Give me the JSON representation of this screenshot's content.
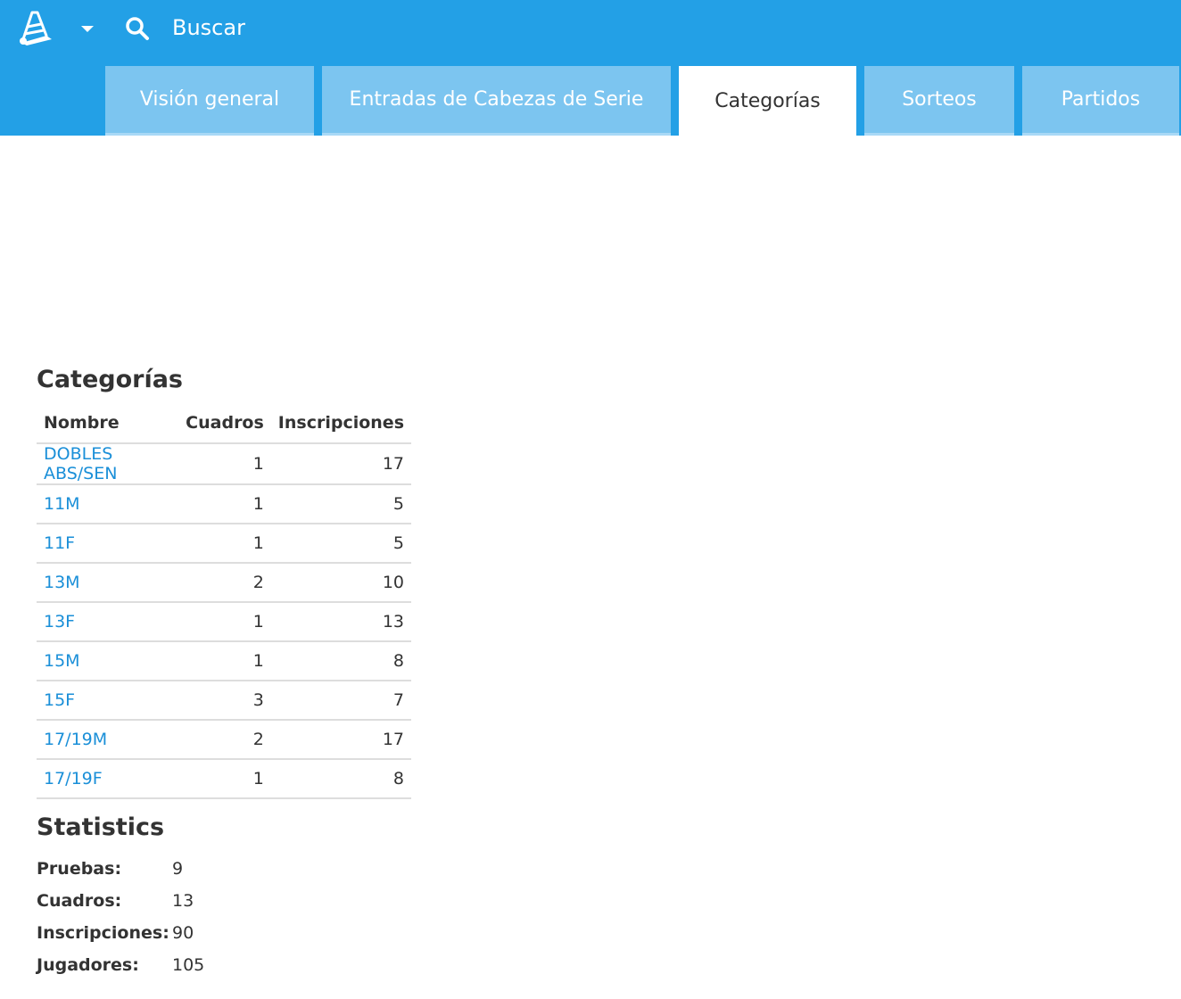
{
  "header": {
    "search_label": "Buscar",
    "brand_color": "#23a0e6",
    "tab_color": "#7cc5f0"
  },
  "tabs": [
    {
      "label": "Visión general",
      "active": false
    },
    {
      "label": "Entradas de Cabezas de Serie",
      "active": false
    },
    {
      "label": "Categorías",
      "active": true
    },
    {
      "label": "Sorteos",
      "active": false
    },
    {
      "label": "Partidos",
      "active": false
    }
  ],
  "categories": {
    "title": "Categorías",
    "columns": [
      "Nombre",
      "Cuadros",
      "Inscripciones"
    ],
    "rows": [
      {
        "name": "DOBLES ABS/SEN",
        "cuadros": "1",
        "inscripciones": "17"
      },
      {
        "name": "11M",
        "cuadros": "1",
        "inscripciones": "5"
      },
      {
        "name": "11F",
        "cuadros": "1",
        "inscripciones": "5"
      },
      {
        "name": "13M",
        "cuadros": "2",
        "inscripciones": "10"
      },
      {
        "name": "13F",
        "cuadros": "1",
        "inscripciones": "13"
      },
      {
        "name": "15M",
        "cuadros": "1",
        "inscripciones": "8"
      },
      {
        "name": "15F",
        "cuadros": "3",
        "inscripciones": "7"
      },
      {
        "name": "17/19M",
        "cuadros": "2",
        "inscripciones": "17"
      },
      {
        "name": "17/19F",
        "cuadros": "1",
        "inscripciones": "8"
      }
    ],
    "link_color": "#1a8fd8"
  },
  "statistics": {
    "title": "Statistics",
    "items": [
      {
        "label": "Pruebas:",
        "value": "9"
      },
      {
        "label": "Cuadros:",
        "value": "13"
      },
      {
        "label": "Inscripciones:",
        "value": "90"
      },
      {
        "label": "Jugadores:",
        "value": "105"
      }
    ]
  },
  "icons": {
    "logo": "shuttlecock-logo-icon",
    "dropdown": "caret-down-icon",
    "search": "search-icon"
  }
}
